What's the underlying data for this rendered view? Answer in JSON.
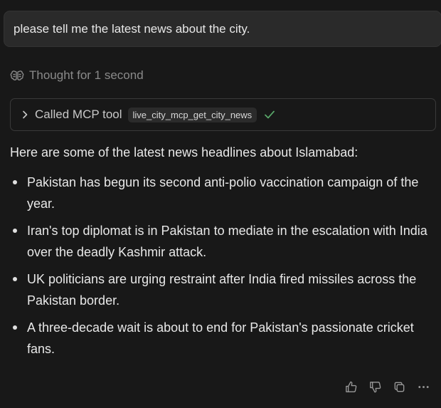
{
  "user_message": "please tell me the latest news about the city.",
  "thought": {
    "icon": "brain-icon",
    "text": "Thought for 1 second"
  },
  "tool_call": {
    "label": "Called MCP tool",
    "tool_name": "live_city_mcp_get_city_news",
    "status_icon": "check-icon",
    "status_color": "#5aa96a"
  },
  "response": {
    "intro": "Here are some of the latest news headlines about Islamabad:",
    "items": [
      "Pakistan has begun its second anti-polio vaccination campaign of the year.",
      "Iran's top diplomat is in Pakistan to mediate in the escalation with India over the deadly Kashmir attack.",
      "UK politicians are urging restraint after India fired missiles across the Pakistan border.",
      "A three-decade wait is about to end for Pakistan's passionate cricket fans."
    ]
  },
  "actions": [
    "thumbs-up-icon",
    "thumbs-down-icon",
    "copy-icon",
    "more-icon"
  ]
}
